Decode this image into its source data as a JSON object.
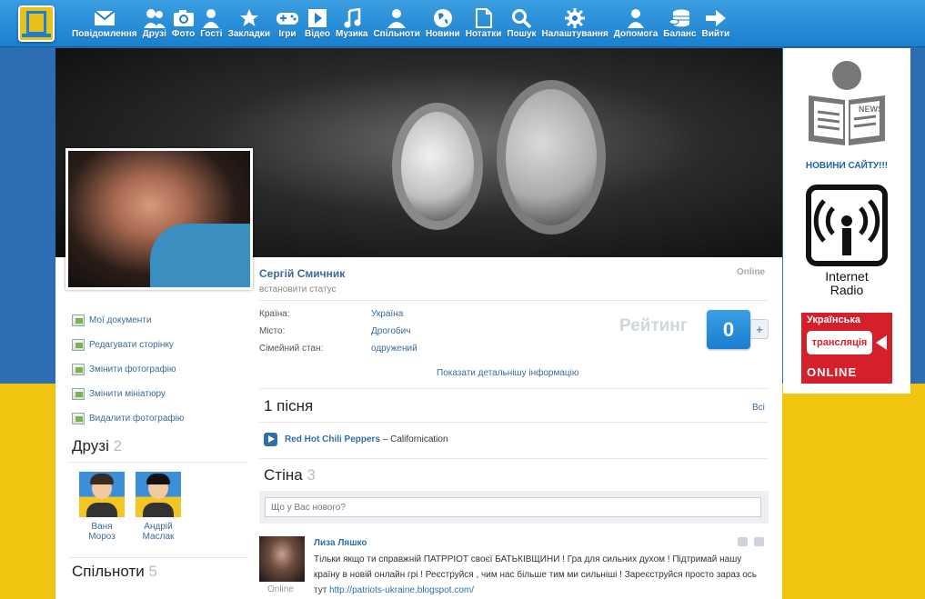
{
  "nav": [
    {
      "label": "Повідомлення",
      "icon": "mail-icon"
    },
    {
      "label": "Друзі",
      "icon": "friends-icon"
    },
    {
      "label": "Фото",
      "icon": "camera-icon"
    },
    {
      "label": "Гості",
      "icon": "guests-icon"
    },
    {
      "label": "Закладки",
      "icon": "star-icon"
    },
    {
      "label": "Ігри",
      "icon": "gamepad-icon"
    },
    {
      "label": "Відео",
      "icon": "play-icon"
    },
    {
      "label": "Музика",
      "icon": "music-note-icon"
    },
    {
      "label": "Спільноти",
      "icon": "community-icon"
    },
    {
      "label": "Новини",
      "icon": "globe-icon"
    },
    {
      "label": "Нотатки",
      "icon": "note-icon"
    },
    {
      "label": "Пошук",
      "icon": "search-icon"
    },
    {
      "label": "Налаштування",
      "icon": "gear-icon"
    },
    {
      "label": "Допомога",
      "icon": "help-icon"
    },
    {
      "label": "Баланс",
      "icon": "coins-icon"
    },
    {
      "label": "Вийти",
      "icon": "exit-arrow-icon"
    }
  ],
  "profile": {
    "name": "Сергій Смичник",
    "status_link": "встановити статус",
    "online": "Online",
    "info": [
      {
        "k": "Країна:",
        "v": "Україна"
      },
      {
        "k": "Місто:",
        "v": "Дрогобич"
      },
      {
        "k": "Сімейний стан:",
        "v": "одружений"
      }
    ],
    "show_more": "Показати детальнішу інформацію",
    "rating_label": "Рейтинг",
    "rating_value": "0",
    "rating_plus": "+"
  },
  "sidebar": {
    "links": [
      "Мої документи",
      "Редагувати сторінку",
      "Змінити фотографію",
      "Змінити мініатюру",
      "Видалити фотографію"
    ],
    "friends_title": "Друзі",
    "friends_count": "2",
    "friends": [
      {
        "first": "Ваня",
        "last": "Мороз"
      },
      {
        "first": "Андрій",
        "last": "Маслак"
      }
    ],
    "communities_title": "Спільноти",
    "communities_count": "5"
  },
  "content": {
    "songs_title": "1 пісня",
    "all_link": "Всі",
    "song_artist": "Red Hot Chili Peppers",
    "song_sep": " – ",
    "song_title": "Californication",
    "wall_title": "Стіна",
    "wall_count": "3",
    "wall_placeholder": "Що у Вас нового?",
    "post": {
      "author": "Лиза Ляшко",
      "text": "Тільки якщо ти справжній ПАТРРІОТ своєї БАТЬКІВЩИНИ ! Гра для сильних духом ! Підтримай нашу країну в новій онлайн грі ! Реєструйся , чим нас більше тим ми сильніші ! Зареєструйся просто зараз ось тут ",
      "link": "http://patriots-ukraine.blogspot.com/",
      "online": "Online"
    }
  },
  "right": {
    "news_label": "НОВИНИ САЙТУ!!!",
    "news_badge": "NEWS",
    "radio_label_1": "Internet",
    "radio_label_2": "Radio",
    "ua_line1": "Українська",
    "ua_line2": "трансляція",
    "ua_line3": "ONLINE"
  },
  "colors": {
    "nav": "#1c7fcf",
    "link": "#3b6a9a",
    "flag_blue": "#2d6db3",
    "flag_yellow": "#f1c40f",
    "radio_red": "#d4202a"
  }
}
